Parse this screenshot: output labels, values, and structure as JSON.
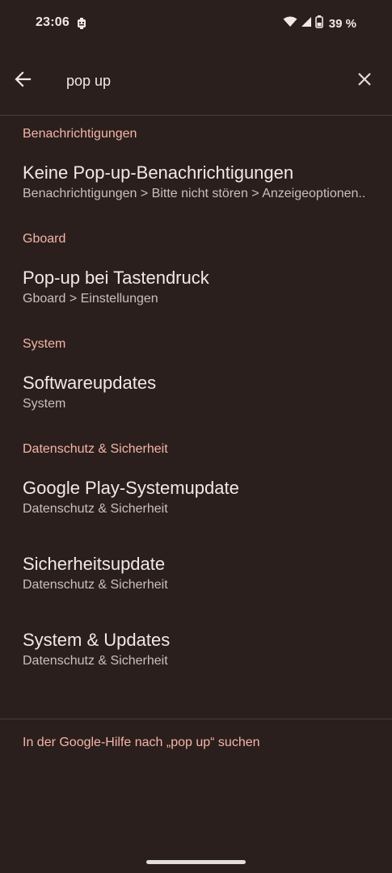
{
  "status": {
    "time": "23:06",
    "battery": "39 %"
  },
  "search": {
    "query": "pop up"
  },
  "sections": [
    {
      "header": "Benachrichtigungen",
      "items": [
        {
          "title": "Keine Pop-up-Benachrichtigungen",
          "subtitle": "Benachrichtigungen > Bitte nicht stören > Anzeigeoptionen.."
        }
      ]
    },
    {
      "header": "Gboard",
      "items": [
        {
          "title": "Pop-up bei Tastendruck",
          "subtitle": "Gboard > Einstellungen"
        }
      ]
    },
    {
      "header": "System",
      "items": [
        {
          "title": "Softwareupdates",
          "subtitle": "System"
        }
      ]
    },
    {
      "header": "Datenschutz & Sicherheit",
      "items": [
        {
          "title": "Google Play-Systemupdate",
          "subtitle": "Datenschutz & Sicherheit"
        },
        {
          "title": "Sicherheitsupdate",
          "subtitle": "Datenschutz & Sicherheit"
        },
        {
          "title": "System & Updates",
          "subtitle": "Datenschutz & Sicherheit"
        }
      ]
    }
  ],
  "footer": {
    "help_link": "In der Google-Hilfe nach „pop up“ suchen"
  },
  "colors": {
    "background": "#2a1f1d",
    "accent": "#f5b5a6",
    "text_primary": "#f2e8e6",
    "text_secondary": "#cbbfbc"
  },
  "icons": {
    "back": "arrow-back-icon",
    "clear": "close-icon",
    "wifi": "wifi-icon",
    "signal": "signal-icon",
    "battery": "battery-icon",
    "notification": "notification-icon"
  }
}
